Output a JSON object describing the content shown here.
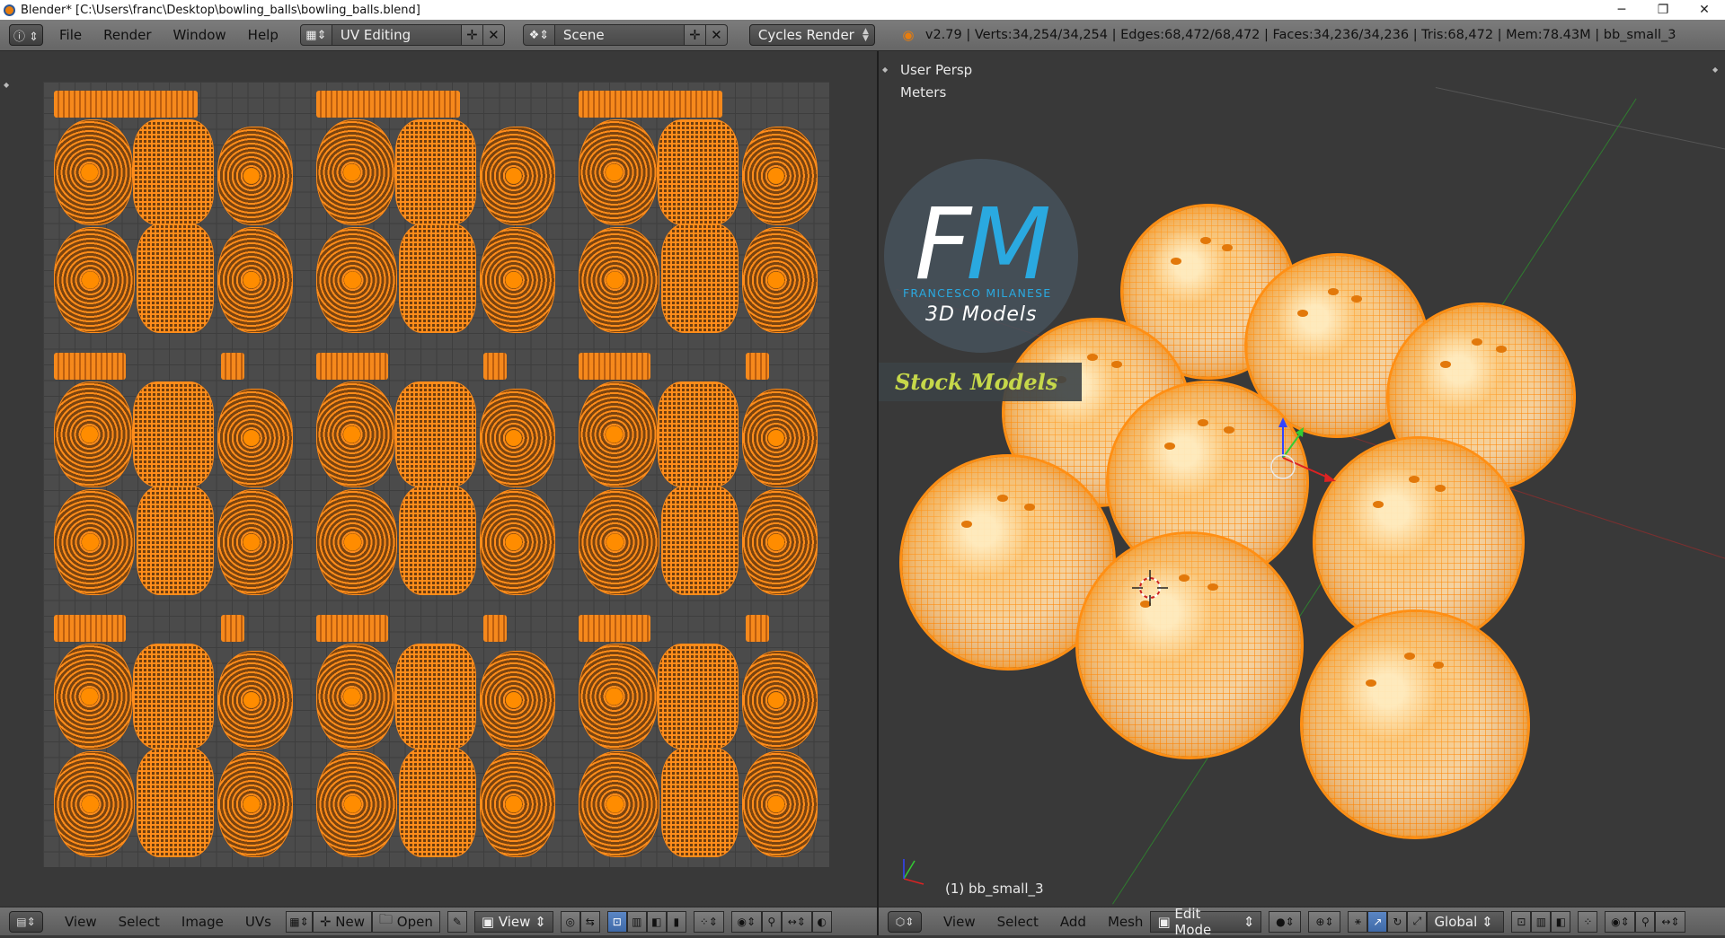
{
  "window": {
    "title": "Blender* [C:\\Users\\franc\\Desktop\\bowling_balls\\bowling_balls.blend]",
    "controls": {
      "minimize": "─",
      "maximize": "❐",
      "close": "✕"
    }
  },
  "header": {
    "editor_icon": "info-icon",
    "menus": [
      "File",
      "Render",
      "Window",
      "Help"
    ],
    "screen_layout": "UV Editing",
    "scene": "Scene",
    "render_engine": "Cycles Render",
    "stats": "v2.79 | Verts:34,254/34,254 | Edges:68,472/68,472 | Faces:34,236/34,236 | Tris:68,472 | Mem:78.43M | bb_small_3"
  },
  "uv_editor": {
    "footer": {
      "menus": [
        "View",
        "Select",
        "Image",
        "UVs"
      ],
      "new_label": "New",
      "open_label": "Open",
      "view_label": "View"
    }
  },
  "viewport": {
    "view_name": "User Persp",
    "units": "Meters",
    "object_name": "(1) bb_small_3",
    "logo": {
      "letters_f": "F",
      "letters_m": "M",
      "name": "FRANCESCO MILANESE",
      "subtitle": "3D Models",
      "band": "Stock Models"
    },
    "footer": {
      "menus": [
        "View",
        "Select",
        "Add",
        "Mesh"
      ],
      "mode": "Edit Mode",
      "orientation": "Global"
    }
  },
  "colors": {
    "accent_orange": "#ff8c1a",
    "logo_blue": "#2aa9e0",
    "stock_green": "#c6d84a"
  }
}
